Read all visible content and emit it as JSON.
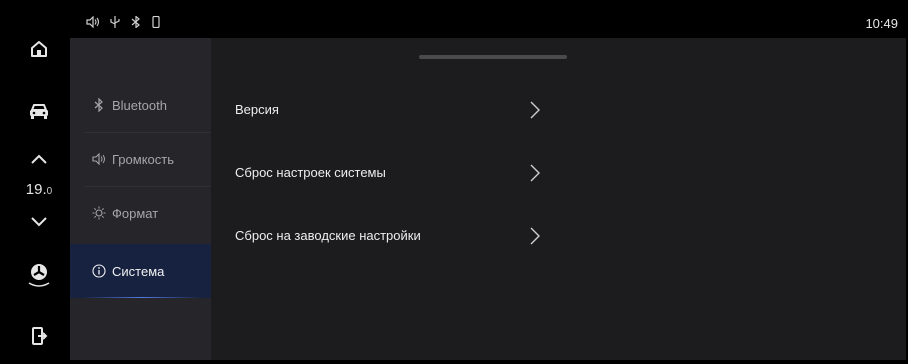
{
  "status": {
    "icons": [
      "volume-icon",
      "usb-icon",
      "bluetooth-icon",
      "phone-icon"
    ],
    "time": "10:49"
  },
  "dock": {
    "items": [
      "home-icon",
      "car-icon",
      "temp-up-icon",
      "temp-down-icon",
      "fan-icon",
      "exit-icon"
    ],
    "temperature": "19.",
    "temperature_unit": "0"
  },
  "sidebar": {
    "items": [
      {
        "label": "Bluetooth",
        "icon": "bluetooth-icon"
      },
      {
        "label": "Громкость",
        "icon": "volume-icon"
      },
      {
        "label": "Формат",
        "icon": "sun-icon"
      },
      {
        "label": "Система",
        "icon": "info-icon",
        "active": true
      }
    ]
  },
  "main": {
    "rows": [
      {
        "label": "Версия"
      },
      {
        "label": "Сброс настроек системы"
      },
      {
        "label": "Сброс на заводские настройки"
      }
    ]
  },
  "colors": {
    "accent": "#5a82f0",
    "active_bg": "#172240",
    "sidebar_bg": "#26262a",
    "content_bg": "#1c1c1e"
  }
}
